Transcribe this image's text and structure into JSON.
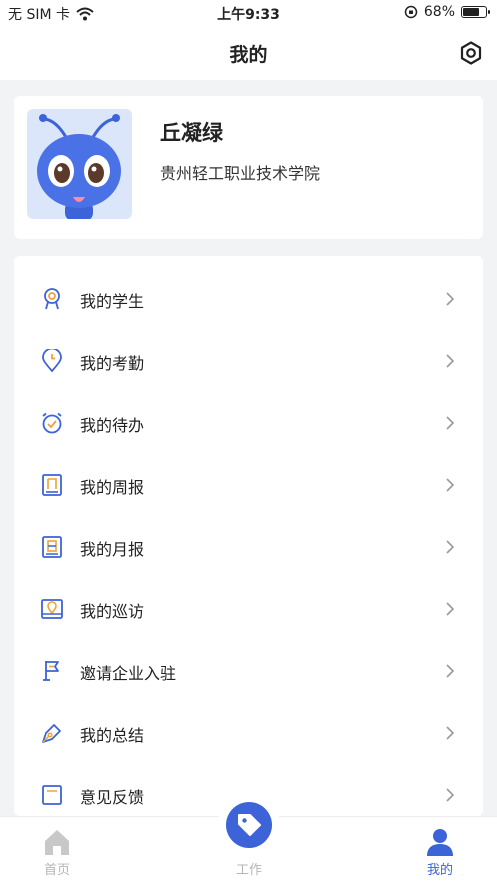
{
  "status_bar": {
    "carrier": "无 SIM 卡",
    "time": "上午9:33",
    "battery": "68%",
    "battery_level": 0.68
  },
  "nav": {
    "title": "我的"
  },
  "profile": {
    "name": "丘凝绿",
    "school": "贵州轻工职业技术学院"
  },
  "menu": [
    {
      "label": "我的学生",
      "icon": "student-badge-icon"
    },
    {
      "label": "我的考勤",
      "icon": "location-clock-icon"
    },
    {
      "label": "我的待办",
      "icon": "alarm-check-icon"
    },
    {
      "label": "我的周报",
      "icon": "weekly-report-icon"
    },
    {
      "label": "我的月报",
      "icon": "monthly-report-icon"
    },
    {
      "label": "我的巡访",
      "icon": "visit-map-icon"
    },
    {
      "label": "邀请企业入驻",
      "icon": "flag-icon"
    },
    {
      "label": "我的总结",
      "icon": "pen-icon"
    },
    {
      "label": "意见反馈",
      "icon": "feedback-icon"
    }
  ],
  "tabs": {
    "home": "首页",
    "work": "工作",
    "mine": "我的"
  },
  "colors": {
    "accent": "#3c63d8",
    "icon_orange": "#f0a23a"
  }
}
